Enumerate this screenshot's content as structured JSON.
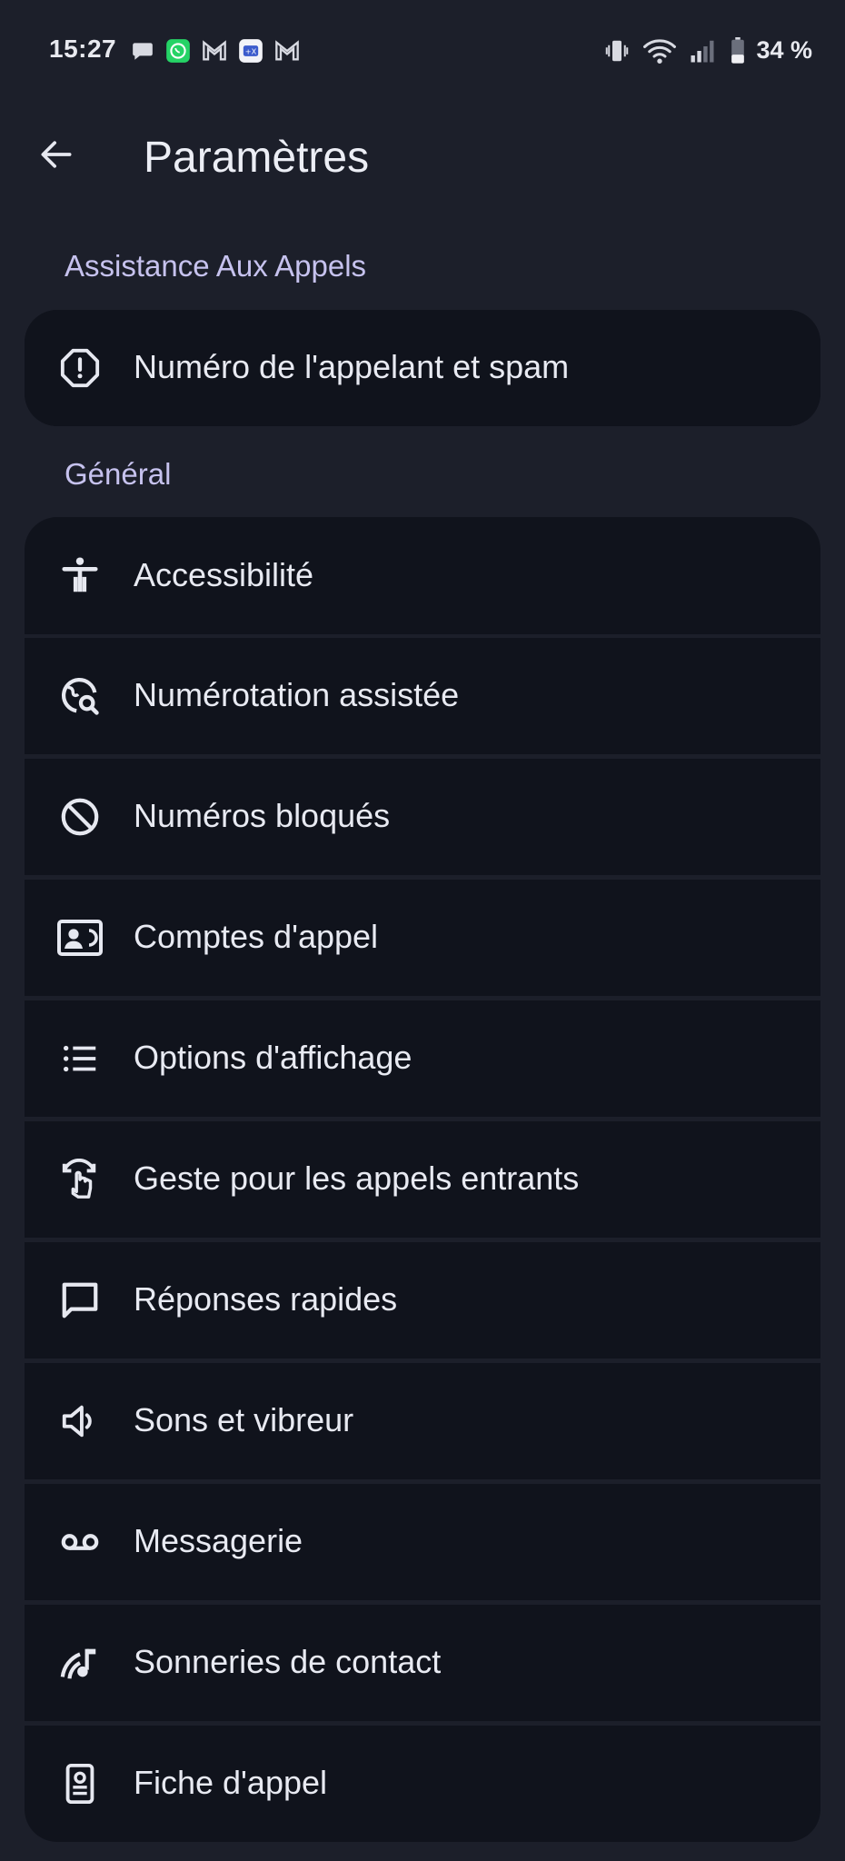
{
  "status_bar": {
    "time": "15:27",
    "battery": "34 %",
    "notification_icons": [
      "chat-bubble-icon",
      "whatsapp-icon",
      "gmail-icon",
      "teams-icon",
      "gmail-icon"
    ],
    "system_icons": [
      "vibrate-icon",
      "wifi-icon",
      "signal-icon",
      "battery-icon"
    ]
  },
  "app_bar": {
    "title": "Paramètres",
    "back_icon": "back-arrow-icon"
  },
  "sections": [
    {
      "header": "Assistance Aux Appels",
      "items": [
        {
          "label": "Numéro de l'appelant et spam",
          "icon": "spam-octagon-icon"
        }
      ]
    },
    {
      "header": "Général",
      "items": [
        {
          "label": "Accessibilité",
          "icon": "accessibility-icon"
        },
        {
          "label": "Numérotation assistée",
          "icon": "assisted-dialing-icon"
        },
        {
          "label": "Numéros bloqués",
          "icon": "block-icon"
        },
        {
          "label": "Comptes d'appel",
          "icon": "calling-account-icon"
        },
        {
          "label": "Options d'affichage",
          "icon": "list-icon"
        },
        {
          "label": "Geste pour les appels entrants",
          "icon": "gesture-icon"
        },
        {
          "label": "Réponses rapides",
          "icon": "message-icon"
        },
        {
          "label": "Sons et vibreur",
          "icon": "volume-icon"
        },
        {
          "label": "Messagerie",
          "icon": "voicemail-icon"
        },
        {
          "label": "Sonneries de contact",
          "icon": "contact-ringtone-icon"
        },
        {
          "label": "Fiche d'appel",
          "icon": "call-card-icon"
        }
      ]
    }
  ],
  "colors": {
    "background": "#1c1f2a",
    "card": "#10131c",
    "accent_header": "#c6c2ee",
    "text": "#e8eaf2"
  }
}
